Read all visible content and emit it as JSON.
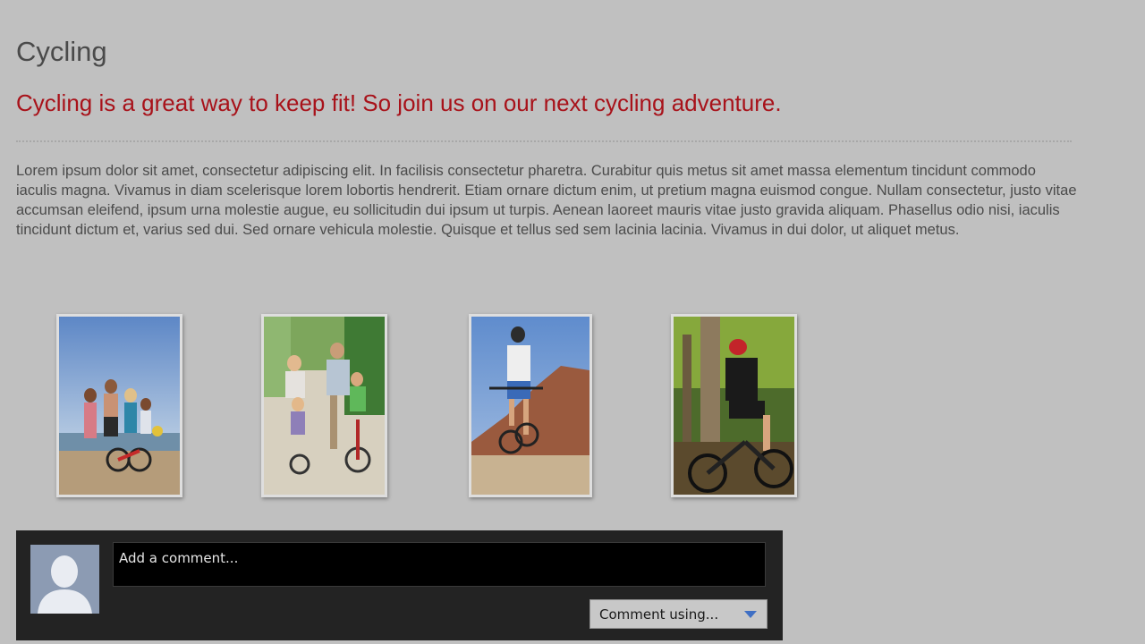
{
  "page": {
    "title": "Cycling",
    "tagline": "Cycling is a great way to keep fit! So join us on our next cycling adventure.",
    "body": "Lorem ipsum dolor sit amet, consectetur adipiscing elit. In facilisis consectetur pharetra. Curabitur quis metus sit amet massa elementum tincidunt commodo iaculis magna. Vivamus in diam scelerisque lorem lobortis hendrerit. Etiam ornare dictum enim, ut pretium magna euismod congue. Nullam consectetur, justo vitae accumsan eleifend, ipsum urna molestie augue, eu sollicitudin dui ipsum ut turpis. Aenean laoreet mauris vitae justo gravida aliquam. Phasellus odio nisi, iaculis tincidunt dictum et, varius sed dui. Sed ornare vehicula molestie. Quisque et tellus sed sem lacinia lacinia. Vivamus in dui dolor, ut aliquet metus."
  },
  "gallery": [
    {
      "subject": "family-on-beach-photo"
    },
    {
      "subject": "family-cycling-path-photo"
    },
    {
      "subject": "rider-on-hill-photo"
    },
    {
      "subject": "mountain-biker-forest-photo"
    }
  ],
  "comments": {
    "input_placeholder": "Add a comment...",
    "comment_using_label": "Comment using...",
    "avatar_icon": "default-avatar-icon",
    "dropdown_icon": "caret-down-icon"
  },
  "colors": {
    "background": "#c0c0c0",
    "title": "#4a4a4a",
    "tagline": "#a8121a",
    "comment_panel": "#232323",
    "caret": "#3f6fc4"
  }
}
